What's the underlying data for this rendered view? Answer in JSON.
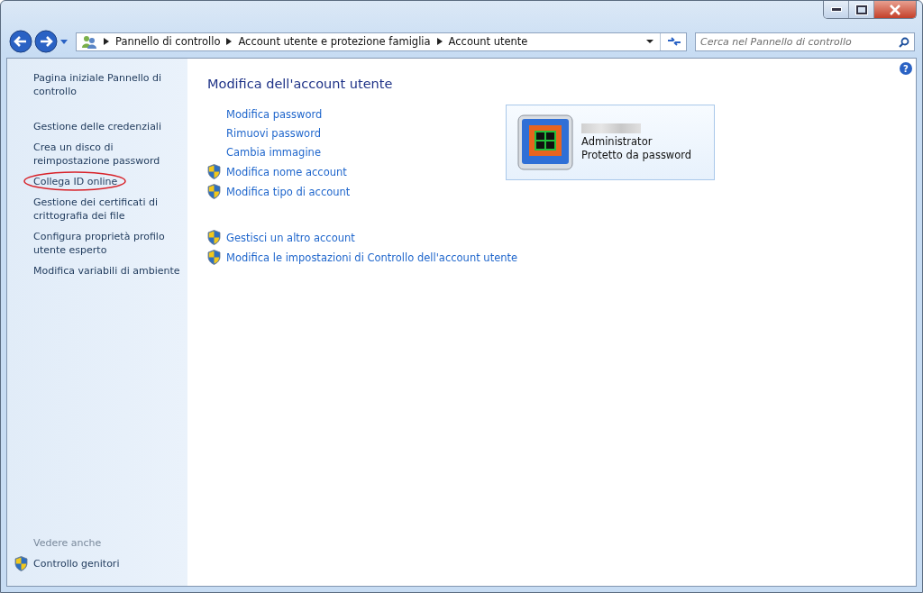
{
  "address_bar": {
    "crumbs": [
      "Pannello di controllo",
      "Account utente e protezione famiglia",
      "Account utente"
    ]
  },
  "search": {
    "placeholder": "Cerca nel Pannello di controllo"
  },
  "help_button": "?",
  "sidebar": {
    "items": [
      {
        "label": "Pagina iniziale Pannello di controllo",
        "circled": false
      },
      {
        "label": "Gestione delle credenziali",
        "circled": false
      },
      {
        "label": "Crea un disco di reimpostazione password",
        "circled": false
      },
      {
        "label": "Collega ID online",
        "circled": true
      },
      {
        "label": "Gestione dei certificati di crittografia dei file",
        "circled": false
      },
      {
        "label": "Configura proprietà profilo utente esperto",
        "circled": false
      },
      {
        "label": "Modifica variabili di ambiente",
        "circled": false
      }
    ],
    "see_also": {
      "heading": "Vedere anche",
      "items": [
        {
          "label": "Controllo genitori",
          "shield": true
        }
      ]
    }
  },
  "main": {
    "title": "Modifica dell'account utente",
    "task_groups": [
      [
        {
          "label": "Modifica password",
          "shield": false
        },
        {
          "label": "Rimuovi password",
          "shield": false
        },
        {
          "label": "Cambia immagine",
          "shield": false
        },
        {
          "label": "Modifica nome account",
          "shield": true
        },
        {
          "label": "Modifica tipo di account",
          "shield": true
        }
      ],
      [
        {
          "label": "Gestisci un altro account",
          "shield": true
        },
        {
          "label": "Modifica le impostazioni di Controllo dell'account utente",
          "shield": true
        }
      ]
    ],
    "account": {
      "type": "Administrator",
      "status": "Protetto da password"
    }
  }
}
